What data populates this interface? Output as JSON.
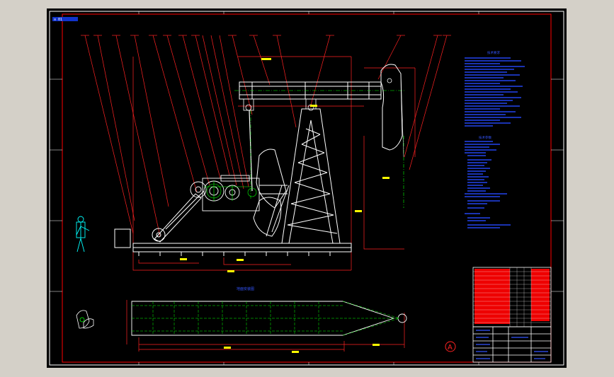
{
  "drawing": {
    "tag_label": "≡ 01",
    "section_title": "地面安装图",
    "revision_mark": "A",
    "notes_block_1": {
      "heading": "技术要求"
    },
    "notes_block_2": {
      "heading": "技术参数"
    },
    "colors": {
      "background": "#000000",
      "border": "#ffffff",
      "frame_red": "#ff0000",
      "outline_white": "#ffffff",
      "center_green": "#00ff00",
      "dimension_yellow": "#ffff00",
      "annotation_blue": "#3355ff",
      "figure_cyan": "#00ffff",
      "title_block_fill": "#ff0000"
    },
    "icons": [
      "human-figure-icon",
      "workpiece-icon",
      "revision-circle-icon"
    ]
  }
}
